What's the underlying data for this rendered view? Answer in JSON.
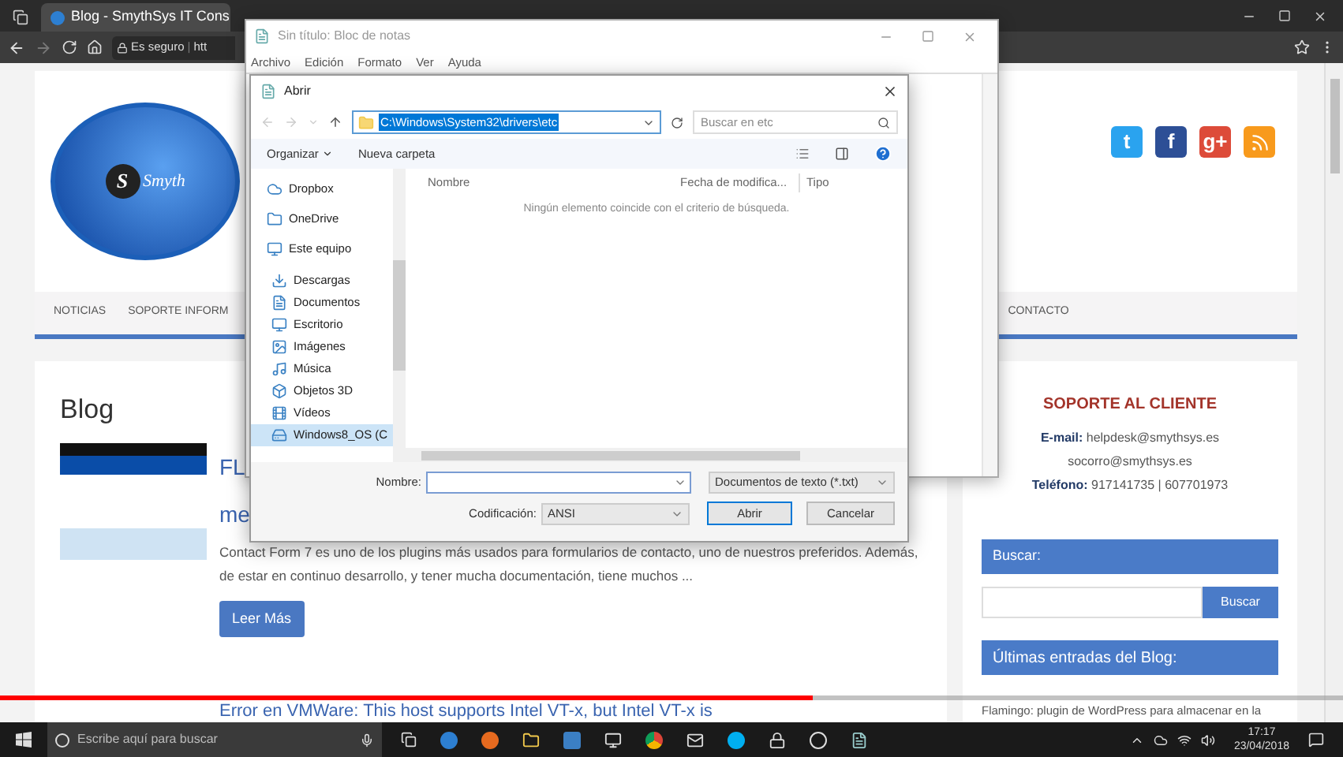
{
  "browser": {
    "tab": {
      "title": "Blog - SmythSys IT Cons",
      "selected": true
    },
    "security": "Es seguro",
    "separator": "|",
    "url": "htt"
  },
  "site": {
    "logo": {
      "letter": "S",
      "text": "Smyth"
    },
    "social": [
      {
        "label": "t",
        "color": "#2aa3ef"
      },
      {
        "label": "f",
        "color": "#2d4f96"
      },
      {
        "label": "g+",
        "color": "#dd4b39"
      }
    ],
    "nav": [
      "NOTICIAS",
      "SOPORTE INFORM",
      "CONTACTO"
    ],
    "blog": {
      "heading": "Blog",
      "title_lines": [
        "FL",
        "me"
      ],
      "excerpt": "Contact Form 7 es uno de los plugins más usados para formularios de contacto, uno de nuestros preferidos. Además, de estar en continuo desarrollo, y tener mucha documentación, tiene muchos ...",
      "button": "Leer Más",
      "next_title": "Error en VMWare: This host supports Intel VT-x, but Intel VT-x is"
    },
    "support": {
      "title": "SOPORTE AL CLIENTE",
      "email_label": "E-mail:",
      "emails": [
        "helpdesk@smythsys.es",
        "socorro@smythsys.es"
      ],
      "phone_label": "Teléfono:",
      "phone": "917141735 | 607701973"
    },
    "search": {
      "heading": "Buscar:",
      "button": "Buscar"
    },
    "recent": {
      "heading": "Últimas entradas del Blog:",
      "items": [
        "Flamingo: plugin de WordPress para almacenar en la"
      ]
    }
  },
  "notepad": {
    "title": "Sin título: Bloc de notas",
    "menu": [
      "Archivo",
      "Edición",
      "Formato",
      "Ver",
      "Ayuda"
    ]
  },
  "dialog": {
    "title": "Abrir",
    "path": "C:\\Windows\\System32\\drivers\\etc",
    "path_selected": true,
    "search_placeholder": "Buscar en etc",
    "toolbar": [
      "Organizar",
      "Nueva carpeta"
    ],
    "tree": [
      {
        "label": "Dropbox",
        "selected": false
      },
      {
        "label": "OneDrive",
        "selected": false
      },
      {
        "label": "Este equipo",
        "selected": false,
        "children": [
          {
            "label": "Descargas",
            "selected": false
          },
          {
            "label": "Documentos",
            "selected": false
          },
          {
            "label": "Escritorio",
            "selected": false
          },
          {
            "label": "Imágenes",
            "selected": false
          },
          {
            "label": "Música",
            "selected": false
          },
          {
            "label": "Objetos 3D",
            "selected": false
          },
          {
            "label": "Vídeos",
            "selected": false
          },
          {
            "label": "Windows8_OS (C",
            "selected": true
          }
        ]
      }
    ],
    "columns": [
      "Nombre",
      "Fecha de modifica...",
      "Tipo"
    ],
    "empty_message": "Ningún elemento coincide con el criterio de búsqueda.",
    "name_label": "Nombre:",
    "filetype": "Documentos de texto (*.txt)",
    "encoding_label": "Codificación:",
    "encoding": "ANSI",
    "open_button": "Abrir",
    "cancel_button": "Cancelar"
  },
  "video": {
    "level": 0.605
  },
  "taskbar": {
    "search_placeholder": "Escribe aquí para buscar",
    "time": "17:17",
    "date": "23/04/2018"
  }
}
